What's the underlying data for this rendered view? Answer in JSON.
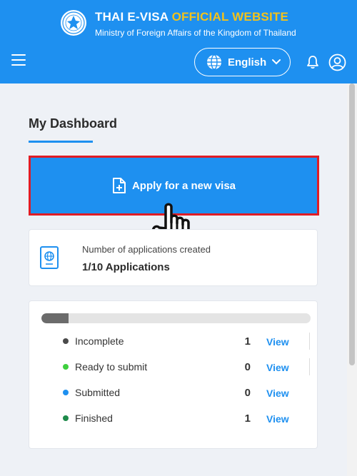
{
  "header": {
    "title_main": "THAI E-VISA ",
    "title_accent": "OFFICIAL WEBSITE",
    "subtitle": "Ministry of Foreign Affairs of the Kingdom of Thailand",
    "language": "English",
    "colors": {
      "brand": "#1e90f0",
      "accent": "#f2c21b"
    },
    "icons": [
      "hamburger-menu-icon",
      "globe-icon",
      "chevron-down-icon",
      "bell-icon",
      "user-icon"
    ]
  },
  "dashboard": {
    "title": "My Dashboard",
    "apply_button": "Apply for a new visa",
    "applications": {
      "label": "Number of applications created",
      "count": "1/10 Applications"
    },
    "progress": 0.1,
    "status": [
      {
        "name": "Incomplete",
        "count": "1",
        "action": "View",
        "color": "#4a4a4a"
      },
      {
        "name": "Ready to submit",
        "count": "0",
        "action": "View",
        "color": "#3ecf3e"
      },
      {
        "name": "Submitted",
        "count": "0",
        "action": "View",
        "color": "#1e90f0"
      },
      {
        "name": "Finished",
        "count": "1",
        "action": "View",
        "color": "#1e8a4a"
      }
    ]
  }
}
